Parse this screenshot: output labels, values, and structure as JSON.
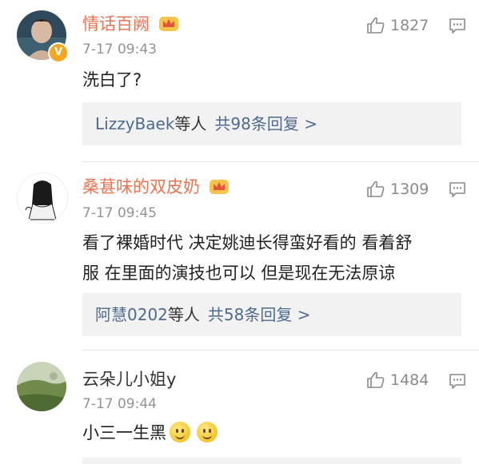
{
  "comments": [
    {
      "name": "情话百阙",
      "time": "7-17 09:43",
      "likes": "1827",
      "text": "洗白了?",
      "reply_users": "LizzyBaek",
      "reply_suffix": "等人",
      "reply_total": "共98条回复 >",
      "vip": true,
      "verified_badge": "V"
    },
    {
      "name": "桑葚味的双皮奶",
      "time": "7-17 09:45",
      "likes": "1309",
      "text_line1": "看了裸婚时代 决定姚迪长得蛮好看的 看着舒",
      "text_line2": "服  在里面的演技也可以  但是现在无法原谅",
      "reply_users": "阿慧0202",
      "reply_suffix": "等人",
      "reply_total": "共58条回复 >",
      "vip": true
    },
    {
      "name": "云朵儿小姐y",
      "time": "7-17 09:44",
      "likes": "1484",
      "text": "小三一生黑",
      "emojis": [
        "smile-emoji",
        "smile-emoji"
      ],
      "vip": false
    }
  ],
  "colors": {
    "vip_name": "#eb7350",
    "link": "#4e6a90",
    "meta": "#939393"
  },
  "icons": [
    "thumbs-up-icon",
    "reply-icon",
    "crown-icon",
    "verified-badge-icon"
  ]
}
